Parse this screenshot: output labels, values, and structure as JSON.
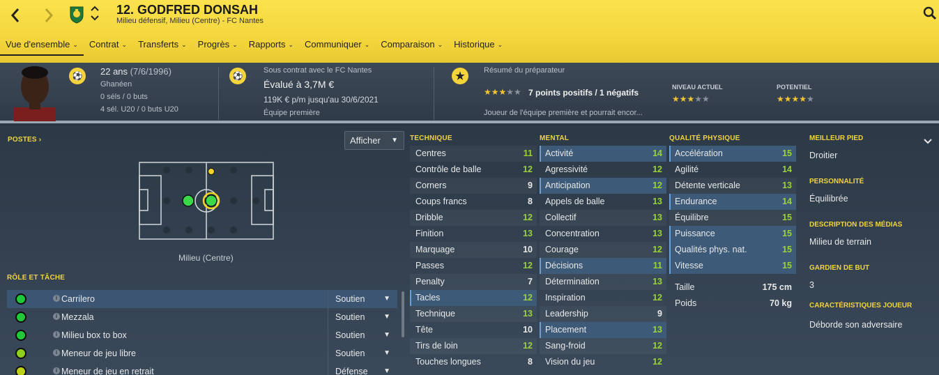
{
  "header": {
    "player_name": "12. GODFRED DONSAH",
    "player_subtitle": "Milieu défensif, Milieu (Centre) - FC Nantes",
    "icons": [
      "back-icon",
      "forward-icon",
      "club-crest-icon",
      "up-icon",
      "down-icon",
      "search-icon"
    ]
  },
  "tabs": [
    {
      "label": "Vue d'ensemble",
      "active": true
    },
    {
      "label": "Contrat"
    },
    {
      "label": "Transferts"
    },
    {
      "label": "Progrès"
    },
    {
      "label": "Rapports"
    },
    {
      "label": "Communiquer"
    },
    {
      "label": "Comparaison"
    },
    {
      "label": "Historique"
    }
  ],
  "overview": {
    "age": "22 ans",
    "birthdate": "(7/6/1996)",
    "nationality": "Ghanéen",
    "caps": "0 séls / 0 buts",
    "u20_caps": "4 sél. U20 / 0 buts U20",
    "contract_label": "Sous contrat avec le FC Nantes",
    "value": "Évalué à 3,7M €",
    "wage": "119K € p/m jusqu'au 30/6/2021",
    "squad": "Équipe première",
    "coach_title": "Résumé du préparateur",
    "coach_summary": "7 points positifs / 1 négatifs",
    "coach_stars": 3,
    "coach_note": "Joueur de l'équipe première et pourrait encor...",
    "current_label": "NIVEAU ACTUEL",
    "current_stars": 3,
    "potential_label": "POTENTIEL",
    "potential_stars": 4
  },
  "positions": {
    "title": "POSTES",
    "show_button": "Afficher",
    "position_label": "Milieu (Centre)"
  },
  "roles": {
    "title": "RÔLE ET TÂCHE",
    "items": [
      {
        "name": "Carrilero",
        "duty": "Soutien",
        "color": "#21c93a"
      },
      {
        "name": "Mezzala",
        "duty": "Soutien",
        "color": "#21c93a"
      },
      {
        "name": "Milieu box to box",
        "duty": "Soutien",
        "color": "#21c93a"
      },
      {
        "name": "Meneur de jeu libre",
        "duty": "Soutien",
        "color": "#8fcf1e"
      },
      {
        "name": "Meneur de jeu en retrait",
        "duty": "Défense",
        "color": "#bcd21a"
      }
    ]
  },
  "technique": {
    "title": "TECHNIQUE",
    "rows": [
      {
        "label": "Centres",
        "value": "11",
        "hl": false,
        "g": true
      },
      {
        "label": "Contrôle de balle",
        "value": "12",
        "hl": false,
        "g": true
      },
      {
        "label": "Corners",
        "value": "9",
        "hl": false,
        "g": false
      },
      {
        "label": "Coups francs",
        "value": "8",
        "hl": false,
        "g": false
      },
      {
        "label": "Dribble",
        "value": "12",
        "hl": false,
        "g": true
      },
      {
        "label": "Finition",
        "value": "13",
        "hl": false,
        "g": true
      },
      {
        "label": "Marquage",
        "value": "10",
        "hl": false,
        "g": false
      },
      {
        "label": "Passes",
        "value": "12",
        "hl": false,
        "g": true
      },
      {
        "label": "Penalty",
        "value": "7",
        "hl": false,
        "g": false
      },
      {
        "label": "Tacles",
        "value": "12",
        "hl": true,
        "g": true
      },
      {
        "label": "Technique",
        "value": "13",
        "hl": false,
        "g": true
      },
      {
        "label": "Tête",
        "value": "10",
        "hl": false,
        "g": false
      },
      {
        "label": "Tirs de loin",
        "value": "12",
        "hl": false,
        "g": true
      },
      {
        "label": "Touches longues",
        "value": "8",
        "hl": false,
        "g": false
      }
    ]
  },
  "mental": {
    "title": "MENTAL",
    "rows": [
      {
        "label": "Activité",
        "value": "14",
        "hl": true,
        "g": true
      },
      {
        "label": "Agressivité",
        "value": "12",
        "hl": false,
        "g": true
      },
      {
        "label": "Anticipation",
        "value": "12",
        "hl": true,
        "g": true
      },
      {
        "label": "Appels de balle",
        "value": "13",
        "hl": false,
        "g": true
      },
      {
        "label": "Collectif",
        "value": "13",
        "hl": false,
        "g": true
      },
      {
        "label": "Concentration",
        "value": "13",
        "hl": false,
        "g": true
      },
      {
        "label": "Courage",
        "value": "12",
        "hl": false,
        "g": true
      },
      {
        "label": "Décisions",
        "value": "11",
        "hl": true,
        "g": true
      },
      {
        "label": "Détermination",
        "value": "13",
        "hl": false,
        "g": true
      },
      {
        "label": "Inspiration",
        "value": "12",
        "hl": false,
        "g": true
      },
      {
        "label": "Leadership",
        "value": "9",
        "hl": false,
        "g": false
      },
      {
        "label": "Placement",
        "value": "13",
        "hl": true,
        "g": true
      },
      {
        "label": "Sang-froid",
        "value": "12",
        "hl": false,
        "g": true
      },
      {
        "label": "Vision du jeu",
        "value": "12",
        "hl": false,
        "g": true
      }
    ]
  },
  "physical": {
    "title": "QUALITÉ PHYSIQUE",
    "rows": [
      {
        "label": "Accélération",
        "value": "15",
        "hl": true,
        "g": true
      },
      {
        "label": "Agilité",
        "value": "14",
        "hl": false,
        "g": true
      },
      {
        "label": "Détente verticale",
        "value": "13",
        "hl": false,
        "g": true
      },
      {
        "label": "Endurance",
        "value": "14",
        "hl": true,
        "g": true
      },
      {
        "label": "Équilibre",
        "value": "15",
        "hl": false,
        "g": true
      },
      {
        "label": "Puissance",
        "value": "15",
        "hl": true,
        "g": true
      },
      {
        "label": "Qualités phys. nat.",
        "value": "15",
        "hl": true,
        "g": true
      },
      {
        "label": "Vitesse",
        "value": "15",
        "hl": true,
        "g": true
      }
    ],
    "height_label": "Taille",
    "height_value": "175 cm",
    "weight_label": "Poids",
    "weight_value": "70 kg"
  },
  "info": {
    "foot_title": "MEILLEUR PIED",
    "foot_value": "Droitier",
    "personality_title": "PERSONNALITÉ",
    "personality_value": "Équilibrée",
    "media_title": "DESCRIPTION DES MÉDIAS",
    "media_value": "Milieu de terrain",
    "gk_title": "GARDIEN DE BUT",
    "gk_value": "3",
    "traits_title": "CARACTÉRISTIQUES JOUEUR",
    "traits_value": "Déborde son adversaire"
  }
}
